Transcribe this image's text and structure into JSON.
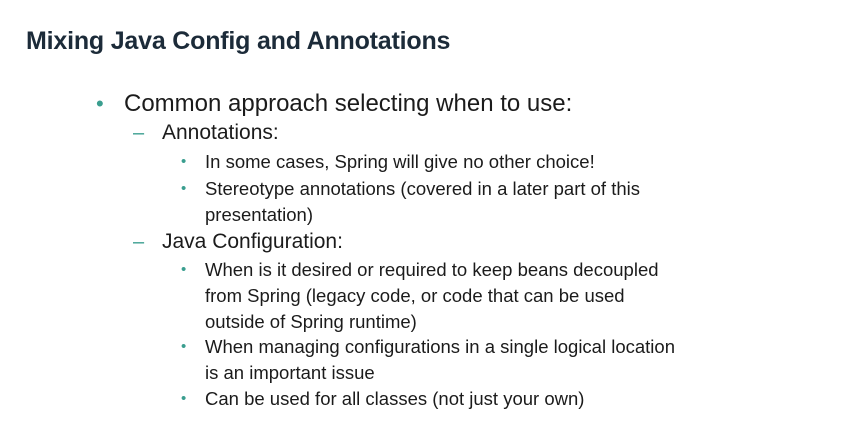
{
  "slide": {
    "title": "Mixing Java Config and Annotations",
    "bullet_marker": "•",
    "dash_marker": "–",
    "main_bullet": "Common approach selecting when to use:",
    "annotations": {
      "heading": "Annotations:",
      "points": [
        [
          "In some cases, Spring will give no other choice!"
        ],
        [
          "Stereotype annotations (covered in a later part of this",
          "presentation)"
        ]
      ]
    },
    "java_config": {
      "heading": "Java Configuration:",
      "points": [
        [
          "When is it desired or required to keep beans decoupled",
          "from Spring (legacy code, or code that can be used",
          "outside of Spring runtime)"
        ],
        [
          "When managing configurations in a single logical location",
          "is an important issue"
        ],
        [
          "Can be used for all classes (not just your own)"
        ]
      ]
    }
  },
  "colors": {
    "title": "#1c2b39",
    "text": "#1b1b1b",
    "bullet": "#3a9e8f",
    "background": "#ffffff"
  }
}
